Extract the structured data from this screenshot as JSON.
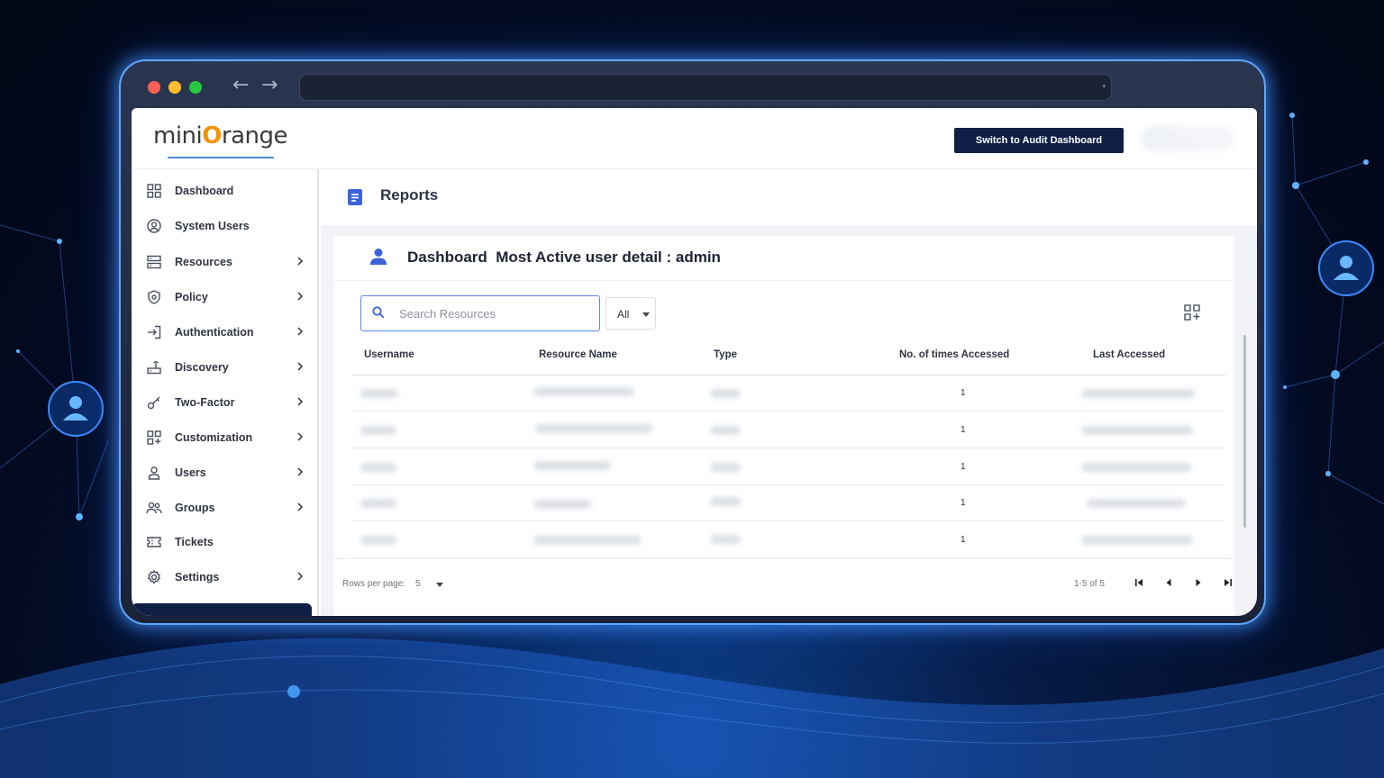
{
  "browser": {
    "traffic_lights": [
      "#ff5f57",
      "#febc2e",
      "#28c840"
    ],
    "back_icon": "arrow-left-icon",
    "forward_icon": "arrow-right-icon",
    "url": ""
  },
  "header": {
    "logo_prefix": "mini",
    "logo_mark": "O",
    "logo_suffix": "range",
    "audit_button": "Switch to Audit Dashboard"
  },
  "sidebar": {
    "items": [
      {
        "label": "Dashboard",
        "icon": "dashboard-grid-icon",
        "has_submenu": false
      },
      {
        "label": "System Users",
        "icon": "user-circle-icon",
        "has_submenu": false
      },
      {
        "label": "Resources",
        "icon": "server-icon",
        "has_submenu": true
      },
      {
        "label": "Policy",
        "icon": "shield-icon",
        "has_submenu": true
      },
      {
        "label": "Authentication",
        "icon": "login-icon",
        "has_submenu": true
      },
      {
        "label": "Discovery",
        "icon": "router-icon",
        "has_submenu": true
      },
      {
        "label": "Two-Factor",
        "icon": "key-icon",
        "has_submenu": true
      },
      {
        "label": "Customization",
        "icon": "grid-plus-icon",
        "has_submenu": true
      },
      {
        "label": "Users",
        "icon": "user-icon",
        "has_submenu": true
      },
      {
        "label": "Groups",
        "icon": "group-icon",
        "has_submenu": true
      },
      {
        "label": "Tickets",
        "icon": "ticket-icon",
        "has_submenu": false
      },
      {
        "label": "Settings",
        "icon": "gear-icon",
        "has_submenu": true
      }
    ]
  },
  "main": {
    "page_title": "Reports",
    "card_title": "Dashboard  Most Active user detail : admin",
    "search": {
      "placeholder": "Search Resources",
      "value": ""
    },
    "filter": {
      "selected": "All"
    },
    "table": {
      "columns": [
        "Username",
        "Resource Name",
        "Type",
        "No. of times Accessed",
        "Last Accessed"
      ],
      "rows": [
        {
          "accessed": "1"
        },
        {
          "accessed": "1"
        },
        {
          "accessed": "1"
        },
        {
          "accessed": "1"
        },
        {
          "accessed": "1"
        }
      ]
    },
    "pagination": {
      "rows_per_page_label": "Rows per page:",
      "rows_per_page": "5",
      "range": "1-5 of 5"
    }
  },
  "colors": {
    "accent_dark": "#0f1f45",
    "brand_orange": "#f39200",
    "link_blue": "#3b63d9"
  }
}
